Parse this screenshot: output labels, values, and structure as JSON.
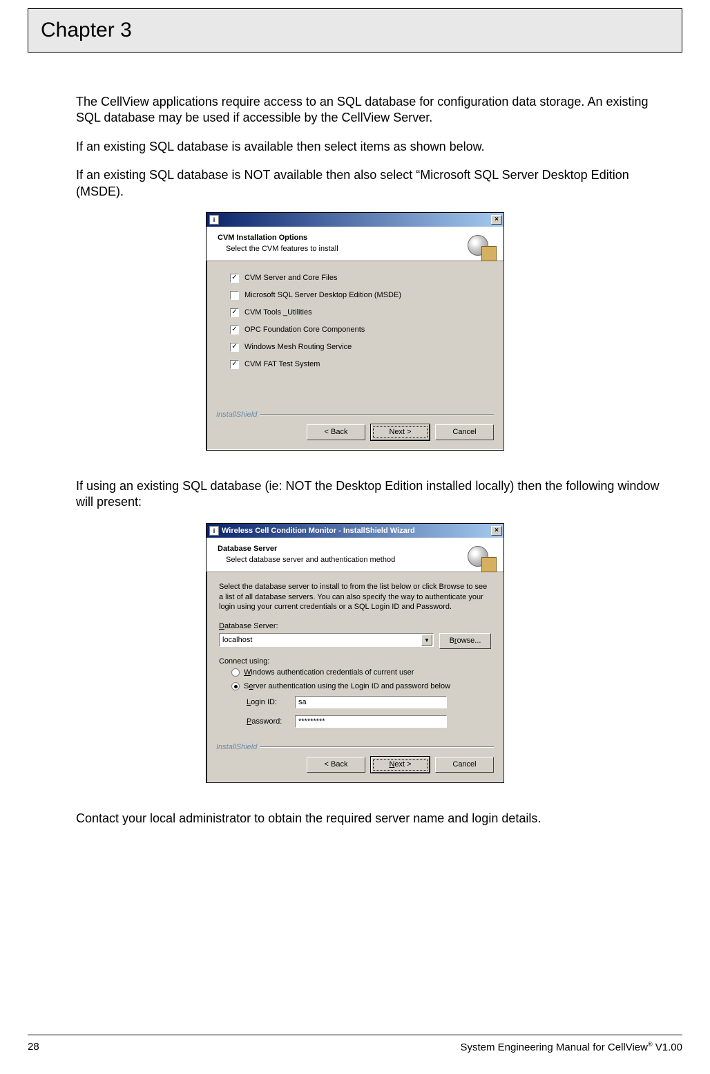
{
  "chapter_title": "Chapter 3",
  "paragraphs": {
    "p1": "The CellView applications require access to an SQL database for configuration data storage.  An existing SQL database may be used if accessible by the CellView Server.",
    "p2": "If an existing SQL database is available then select items as shown below.",
    "p3": "If an existing SQL database is NOT available then also select “Microsoft SQL Server Desktop Edition (MSDE).",
    "p4": "If using an existing SQL database (ie: NOT the Desktop Edition installed locally) then the following window will present:",
    "p5": "Contact your local administrator to obtain the required server name and login details."
  },
  "dialog1": {
    "title": "CVM Installation Options",
    "subtitle": "Select the CVM features to install",
    "options": [
      {
        "label": "CVM Server and Core Files",
        "checked": true
      },
      {
        "label": "Microsoft SQL Server Desktop Edition (MSDE)",
        "checked": false
      },
      {
        "label": "CVM Tools _Utilities",
        "checked": true
      },
      {
        "label": "OPC Foundation Core Components",
        "checked": true
      },
      {
        "label": "Windows Mesh Routing Service",
        "checked": true
      },
      {
        "label": "CVM FAT Test System",
        "checked": true
      }
    ],
    "install_shield": "InstallShield",
    "buttons": {
      "back": "< Back",
      "next": "Next >",
      "cancel": "Cancel"
    }
  },
  "dialog2": {
    "titlebar": "Wireless Cell Condition Monitor - InstallShield Wizard",
    "head_title": "Database Server",
    "head_subtitle": "Select database server and authentication method",
    "description": "Select the database server to install to from the list below or click Browse to see a list of all database servers. You can also specify the way to authenticate your login using your current credentials or a SQL Login ID and Password.",
    "db_server_label": "Database Server:",
    "db_server_value": "localhost",
    "browse": "Browse...",
    "connect_using": "Connect using:",
    "radio_win": "Windows authentication credentials of current user",
    "radio_sql": "Server authentication using the Login ID and password below",
    "login_label": "Login ID:",
    "login_value": "sa",
    "password_label": "Password:",
    "password_value": "*********",
    "install_shield": "InstallShield",
    "buttons": {
      "back": "< Back",
      "next": "Next >",
      "cancel": "Cancel"
    }
  },
  "footer": {
    "page_number": "28",
    "doc_title_pre": "System Engineering Manual for CellView",
    "doc_title_post": " V1.00",
    "reg": "®"
  }
}
